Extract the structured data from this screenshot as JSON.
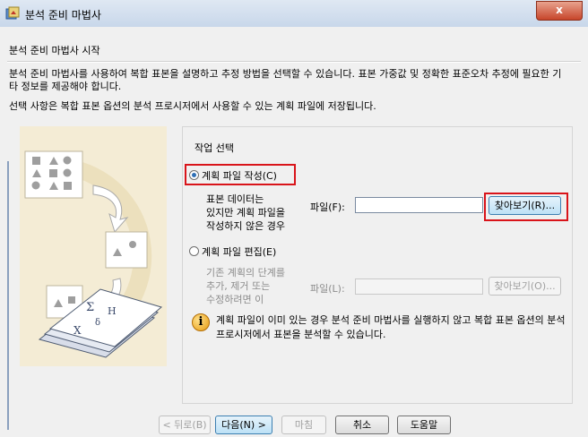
{
  "window": {
    "title": "분석 준비 마법사",
    "close_symbol": "x",
    "icon": "wizard-app-icon"
  },
  "page": {
    "heading": "분석 준비 마법사 시작",
    "description_1": "분석 준비 마법사를 사용하여 복합 표본을 설명하고 추정 방법을 선택할 수 있습니다. 표본 가중값 및 정확한 표준오차 추정에 필요한 기타 정보를 제공해야 합니다.",
    "description_2": "선택 사항은 복합 표본 옵션의 분석 프로시저에서 사용할 수 있는 계획 파일에 저장됩니다."
  },
  "task": {
    "title": "작업 선택",
    "option_create": {
      "label": "계획 파일 작성(C)",
      "selected": true,
      "desc_line1": "표본 데이터는",
      "desc_line2": "있지만 계획 파일을",
      "desc_line3": "작성하지 않은 경우",
      "file_label": "파일(F):",
      "file_value": "",
      "browse_label": "찾아보기(R)..."
    },
    "option_edit": {
      "label": "계획 파일 편집(E)",
      "selected": false,
      "desc_line1": "기존 계획의 단계를",
      "desc_line2": "추가, 제거 또는",
      "desc_line3": "수정하려면 이",
      "file_label": "파일(L):",
      "file_value": "",
      "browse_label": "찾아보기(O)..."
    },
    "info_icon": "info-icon",
    "info_text": "계획 파일이 이미 있는 경우 분석 준비 마법사를 실행하지 않고 복합 표본 옵션의 분석 프로시저에서 표본을 분석할 수 있습니다."
  },
  "buttons": {
    "back": "< 뒤로(B)",
    "next": "다음(N) >",
    "finish": "마침",
    "cancel": "취소",
    "help": "도움말"
  },
  "colors": {
    "highlight": "#d9141a",
    "illustration_bg": "#f4ecd5"
  }
}
